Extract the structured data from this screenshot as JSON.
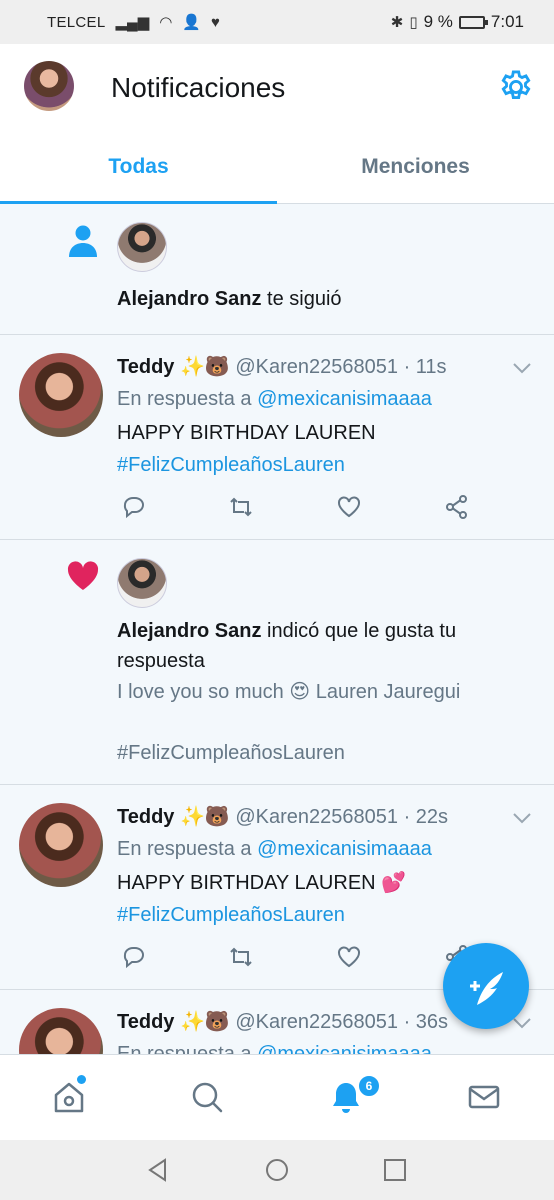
{
  "status_bar": {
    "carrier": "TELCEL",
    "battery": "9 %",
    "time": "7:01"
  },
  "header": {
    "title": "Notificaciones"
  },
  "tabs": [
    {
      "label": "Todas",
      "active": true
    },
    {
      "label": "Menciones",
      "active": false
    }
  ],
  "notifications": [
    {
      "type": "follow",
      "user": "Alejandro Sanz",
      "text": "te siguió"
    },
    {
      "type": "reply",
      "name": "Teddy",
      "emoji": "✨🐻",
      "handle": "@Karen22568051 · 11s",
      "reply_prefix": "En respuesta a",
      "reply_to": "@mexicanisimaaaa",
      "text": "HAPPY BIRTHDAY LAUREN",
      "hashtag": "#FelizCumpleañosLauren"
    },
    {
      "type": "like",
      "user": "Alejandro Sanz",
      "text": "indicó que le gusta tu respuesta",
      "quoted_line1": "I love you so much 😍 Lauren Jauregui",
      "quoted_line2": "#FelizCumpleañosLauren"
    },
    {
      "type": "reply",
      "name": "Teddy",
      "emoji": "✨🐻",
      "handle": "@Karen22568051 · 22s",
      "reply_prefix": "En respuesta a",
      "reply_to": "@mexicanisimaaaa",
      "text": "HAPPY BIRTHDAY LAUREN 💕",
      "hashtag": "#FelizCumpleañosLauren"
    },
    {
      "type": "reply",
      "name": "Teddy",
      "emoji": "✨🐻",
      "handle": "@Karen22568051 · 36s",
      "reply_prefix": "En respuesta a",
      "reply_to": "@mexicanisimaaaa"
    }
  ],
  "bottom_nav": {
    "notifications_badge": "6"
  },
  "colors": {
    "accent": "#1da1f2",
    "like": "#e0245e",
    "feed_bg": "#f3f8fc",
    "muted": "#657786"
  }
}
